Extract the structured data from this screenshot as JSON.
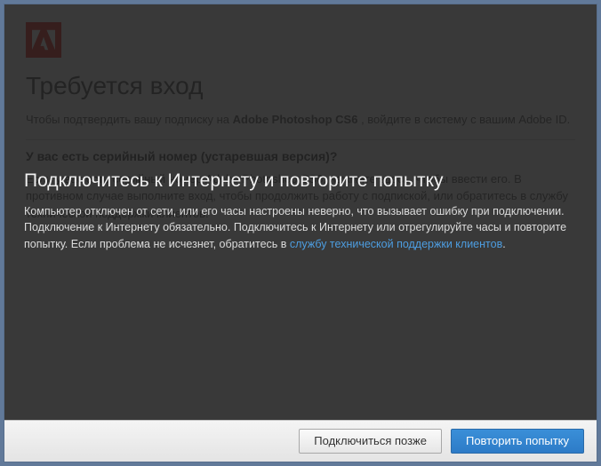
{
  "background": {
    "logo_name": "adobe-logo",
    "title": "Требуется вход",
    "line1_pre": "Чтобы подтвердить вашу подписку на ",
    "line1_strong": "Adobe Photoshop CS6",
    "line1_post": ", войдите в систему с вашим Adobe ID.",
    "subhead": "У вас есть серийный номер (устаревшая версия)?",
    "text2": "Если у вас есть серийный номер Adobe Photoshop CS6, нажмите здесь, чтобы ввести его. В противном случае выполните вход, чтобы продолжить работу с подпиской, или обратитесь в службу технической поддержки клиентов."
  },
  "modal": {
    "title": "Подключитесь к Интернету и повторите попытку",
    "body_pre": "Компьютер отключен от сети, или его часы настроены неверно, что вызывает ошибку при подключении. Подключение к Интернету обязательно. Подключитесь к Интернету или отрегулируйте часы и повторите попытку. Если проблема не исчезнет, обратитесь в ",
    "link_text": "службу технической поддержки клиентов",
    "body_post": "."
  },
  "buttons": {
    "secondary": "Подключиться позже",
    "primary": "Повторить попытку"
  }
}
